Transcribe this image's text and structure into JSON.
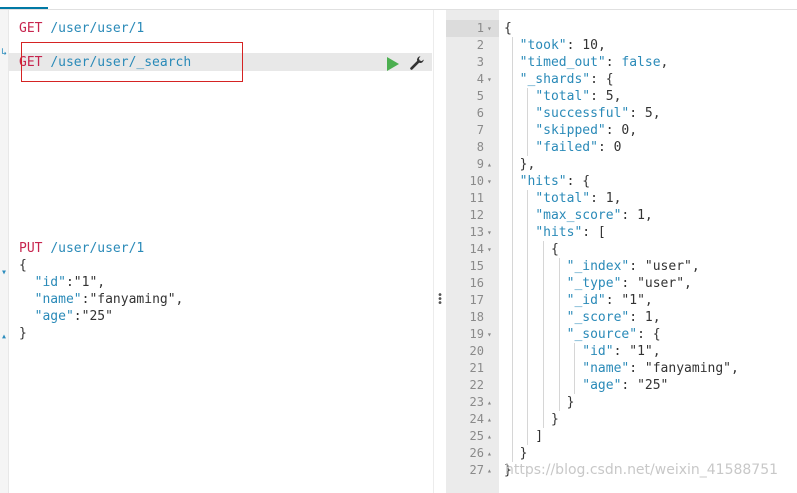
{
  "left_requests": [
    {
      "method": "GET",
      "path": "/user/user/1"
    },
    {
      "method": "GET",
      "path": "/user/user/_search"
    },
    {
      "method": "PUT",
      "path": "/user/user/1"
    }
  ],
  "left_body": [
    "{",
    "  \"id\":\"1\",",
    "  \"name\":\"fanyaming\",",
    "  \"age\":\"25\"",
    "}"
  ],
  "left_body_parts": [
    {
      "k": "\"id\"",
      "v": "\"1\","
    },
    {
      "k": "\"name\"",
      "v": "\"fanyaming\","
    },
    {
      "k": "\"age\"",
      "v": "\"25\""
    }
  ],
  "icons": {
    "run": "play-icon",
    "settings": "wrench-icon",
    "resize": "drag-handle-icon"
  },
  "colors": {
    "method": "#c7254e",
    "path": "#2a8ab8",
    "highlight_box": "#d52323",
    "run": "#4caf50"
  },
  "response_lines": [
    "{",
    "  \"took\": 10,",
    "  \"timed_out\": false,",
    "  \"_shards\": {",
    "    \"total\": 5,",
    "    \"successful\": 5,",
    "    \"skipped\": 0,",
    "    \"failed\": 0",
    "  },",
    "  \"hits\": {",
    "    \"total\": 1,",
    "    \"max_score\": 1,",
    "    \"hits\": [",
    "      {",
    "        \"_index\": \"user\",",
    "        \"_type\": \"user\",",
    "        \"_id\": \"1\",",
    "        \"_score\": 1,",
    "        \"_source\": {",
    "          \"id\": \"1\",",
    "          \"name\": \"fanyaming\",",
    "          \"age\": \"25\"",
    "        }",
    "      }",
    "    ]",
    "  }",
    "}"
  ],
  "line_numbers": [
    "1",
    "2",
    "3",
    "4",
    "5",
    "6",
    "7",
    "8",
    "9",
    "10",
    "11",
    "12",
    "13",
    "14",
    "15",
    "16",
    "17",
    "18",
    "19",
    "20",
    "21",
    "22",
    "23",
    "24",
    "25",
    "26",
    "27"
  ],
  "fold_markers": [
    "▾",
    "",
    "",
    "▾",
    "",
    "",
    "",
    "",
    "▴",
    "▾",
    "",
    "",
    "▾",
    "▾",
    "",
    "",
    "",
    "",
    "▾",
    "",
    "",
    "",
    "▴",
    "▴",
    "▴",
    "▴",
    "▴"
  ],
  "watermark": "https://blog.csdn.net/weixin_41588751"
}
